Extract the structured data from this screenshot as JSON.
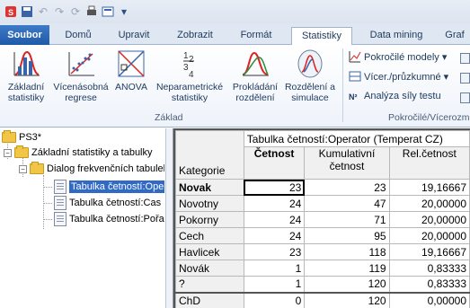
{
  "qat": {
    "icons": [
      "app-icon",
      "save-icon",
      "undo-icon",
      "redo-icon",
      "refresh-icon",
      "print-icon",
      "options-icon",
      "dropdown-icon"
    ]
  },
  "tabs": [
    "Soubor",
    "Domů",
    "Upravit",
    "Zobrazit",
    "Formát",
    "Statistiky",
    "Data mining",
    "Graf"
  ],
  "active_tab": "Statistiky",
  "ribbon": {
    "buttons": [
      {
        "label1": "Základní",
        "label2": "statistiky"
      },
      {
        "label1": "Vícenásobná",
        "label2": "regrese"
      },
      {
        "label1": "ANOVA",
        "label2": ""
      },
      {
        "label1": "Neparametrické",
        "label2": "statistiky"
      },
      {
        "label1": "Prokládání",
        "label2": "rozdělení"
      },
      {
        "label1": "Rozdělení a",
        "label2": "simulace"
      }
    ],
    "group_basic": "Základ",
    "small": [
      "Pokročilé modely ▾",
      "Vícer./průzkumné ▾",
      "Analýza síly testu"
    ],
    "group_advanced": "Pokročilé/Vícerozm"
  },
  "tree": {
    "root": "PS3*",
    "level1": "Základní statistiky a tabulky",
    "level2": "Dialog frekvenčních tabulek",
    "items": [
      "Tabulka četností:Operator",
      "Tabulka četností:Cas",
      "Tabulka četností:Pořadí"
    ]
  },
  "sheet": {
    "title": "Tabulka četností:Operator (Temperat CZ)",
    "corner_label": "Kategorie",
    "headers": {
      "c1": "Četnost",
      "c2a": "Kumulativní",
      "c2b": "četnost",
      "c3": "Rel.četnost"
    },
    "rows": [
      {
        "cat": "Novak",
        "f": "23",
        "cum": "23",
        "rel": "19,16667"
      },
      {
        "cat": "Novotny",
        "f": "24",
        "cum": "47",
        "rel": "20,00000"
      },
      {
        "cat": "Pokorny",
        "f": "24",
        "cum": "71",
        "rel": "20,00000"
      },
      {
        "cat": "Cech",
        "f": "24",
        "cum": "95",
        "rel": "20,00000"
      },
      {
        "cat": "Havlicek",
        "f": "23",
        "cum": "118",
        "rel": "19,16667"
      },
      {
        "cat": "Novák",
        "f": "1",
        "cum": "119",
        "rel": "0,83333"
      },
      {
        "cat": "?",
        "f": "1",
        "cum": "120",
        "rel": "0,83333"
      },
      {
        "cat": "ChD",
        "f": "0",
        "cum": "120",
        "rel": "0,00000"
      }
    ]
  }
}
